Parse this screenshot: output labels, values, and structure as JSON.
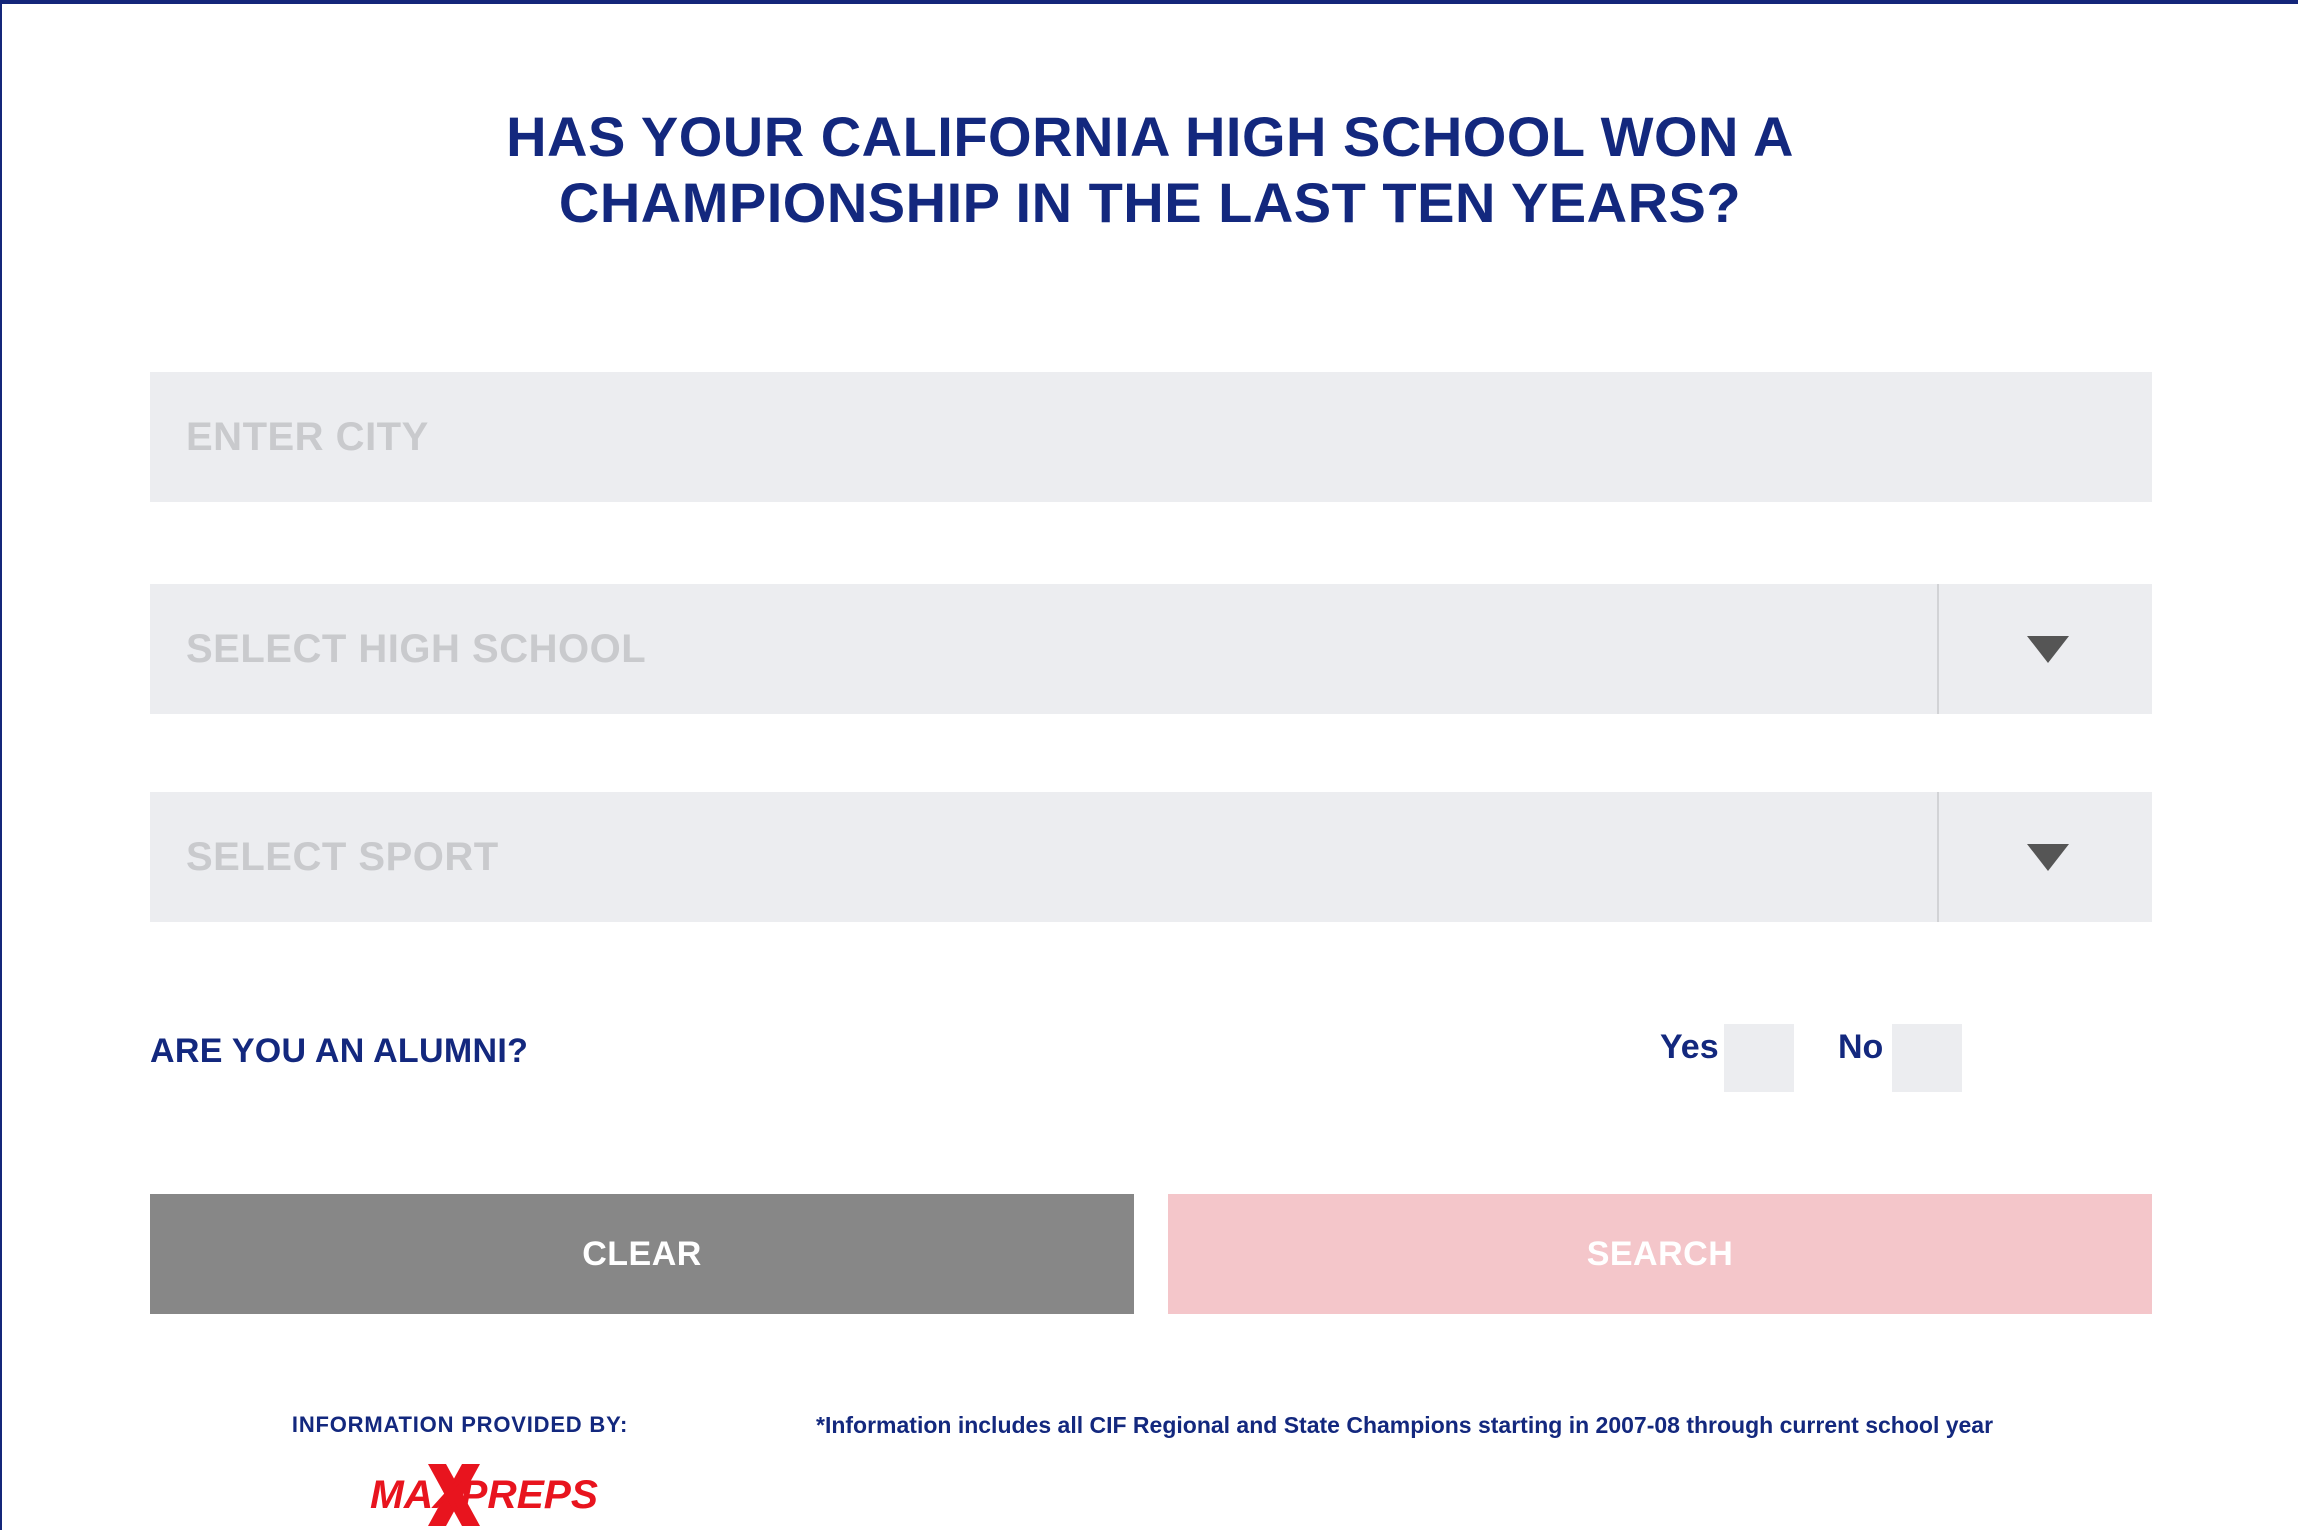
{
  "colors": {
    "brand_navy": "#13287e",
    "field_bg": "#ecedf0",
    "clear_button": "#878787",
    "search_button_disabled": "#f4c6ca",
    "logo_red": "#e8141e"
  },
  "form": {
    "title_line1": "HAS YOUR CALIFORNIA HIGH SCHOOL WON A",
    "title_line2": "CHAMPIONSHIP IN THE LAST TEN YEARS?",
    "city": {
      "placeholder": "ENTER CITY",
      "value": ""
    },
    "high_school": {
      "placeholder": "SELECT HIGH SCHOOL",
      "icon": "chevron-down-icon"
    },
    "sport": {
      "placeholder": "SELECT SPORT",
      "icon": "chevron-down-icon"
    },
    "alumni": {
      "question": "ARE YOU AN ALUMNI?",
      "yes_label": "Yes",
      "no_label": "No"
    },
    "buttons": {
      "clear_label": "CLEAR",
      "search_label": "SEARCH"
    }
  },
  "footer": {
    "provided_by": "INFORMATION PROVIDED BY:",
    "logo_text": "MAXPREPS",
    "note": "*Information includes all CIF Regional and State Champions starting in 2007-08 through current school year"
  }
}
